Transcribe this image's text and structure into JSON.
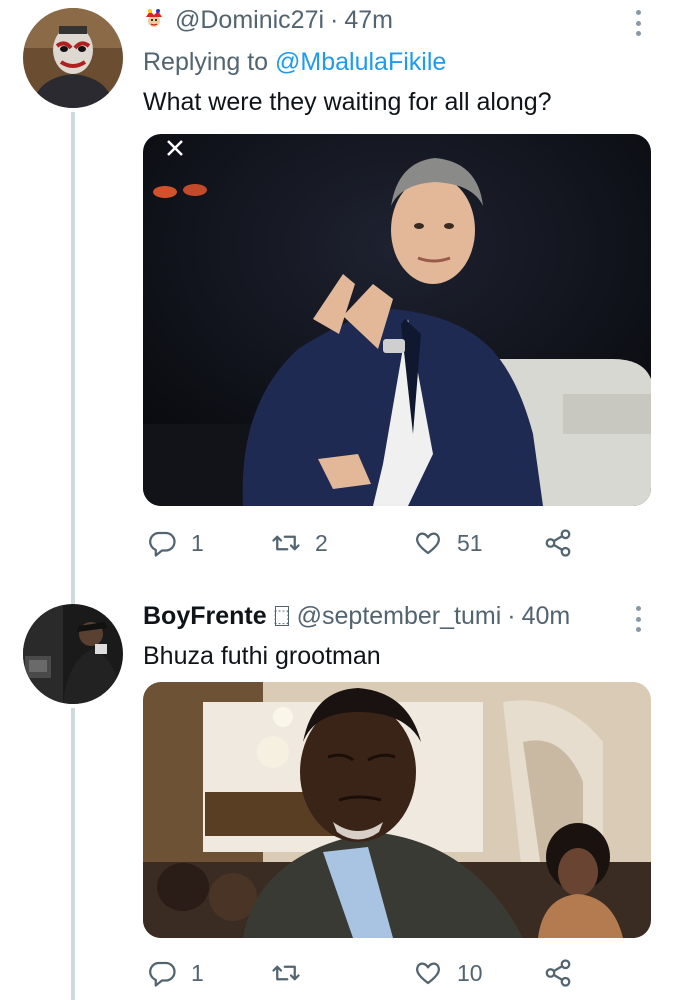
{
  "tweets": [
    {
      "author_handle": "@Dominic27i",
      "time": "47m",
      "replying_prefix": "Replying to",
      "replying_to": "@MbalulaFikile",
      "text": "What were they waiting for all along?",
      "counts": {
        "replies": "1",
        "retweets": "2",
        "likes": "51"
      }
    },
    {
      "author_name": "BoyFrente",
      "author_badge": "⬚",
      "author_handle": "@september_tumi",
      "time": "40m",
      "text": "Bhuza futhi grootman",
      "counts": {
        "replies": "1",
        "retweets": "",
        "likes": "10"
      }
    }
  ],
  "separator": "·",
  "colors": {
    "link": "#1d9bf0",
    "muted": "#536471",
    "thread_line": "#cfd9de"
  },
  "icons": [
    "joker-emoji-icon",
    "more-icon",
    "close-icon",
    "reply-icon",
    "retweet-icon",
    "like-icon",
    "share-icon"
  ]
}
